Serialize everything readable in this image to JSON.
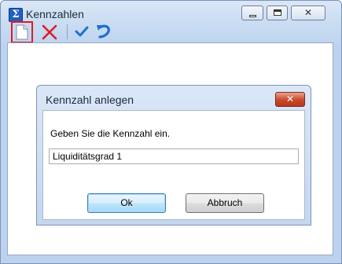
{
  "window": {
    "title": "Kennzahlen",
    "icon": "sigma-icon",
    "icon_glyph": "Σ",
    "controls": {
      "minimize": "minimize-icon",
      "maximize": "maximize-icon",
      "close_glyph": "✕"
    }
  },
  "toolbar": {
    "items": [
      {
        "name": "new-document-icon"
      },
      {
        "name": "delete-icon",
        "color": "#e01b24"
      },
      {
        "name": "checkmark-icon",
        "color": "#1f6fd1"
      },
      {
        "name": "undo-icon",
        "color": "#1f6fd1"
      }
    ],
    "highlight_color": "#e01b24"
  },
  "dialog": {
    "title": "Kennzahl anlegen",
    "close_glyph": "✕",
    "prompt": "Geben Sie die Kennzahl ein.",
    "input_value": "Liquiditätsgrad 1",
    "ok_label": "Ok",
    "cancel_label": "Abbruch"
  }
}
